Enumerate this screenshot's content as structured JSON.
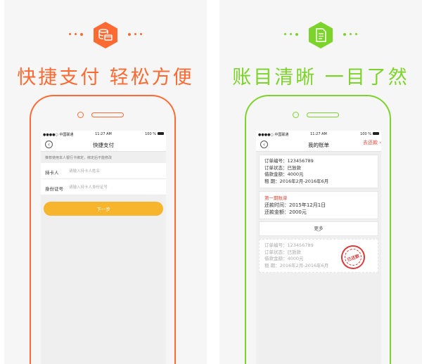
{
  "colors": {
    "orange": "#ff6a33",
    "green": "#7cd32a",
    "gold": "#f7b52e",
    "red": "#e2463a"
  },
  "left": {
    "icon": "database-card-icon",
    "headline": "快捷支付  轻松方便",
    "status": {
      "carrier": "●●●●○ 中国联通",
      "time": "11:27 AM",
      "battery": "100 %"
    },
    "nav_title": "快捷支付",
    "hint": "推荐使用本人银行卡绑定，绑定后不能修改",
    "fields": [
      {
        "label": "持卡人",
        "placeholder": "请输入持卡人姓名"
      },
      {
        "label": "身份证号",
        "placeholder": "请输入持卡人身份证号"
      }
    ],
    "next_label": "下一步"
  },
  "right": {
    "icon": "receipt-icon",
    "headline": "账目清晰  一目了然",
    "status": {
      "carrier": "●●●●○ 中国联通",
      "time": "11:27 AM",
      "battery": "100 %"
    },
    "nav_title": "我的账单",
    "order": {
      "no": "订单编号：123456789",
      "state": "订单状态：已放款",
      "amount": "借款金额：4000元",
      "period": "租      期：2016年2月-2016年6月"
    },
    "bill": {
      "title": "第一期账单",
      "time": "还款时间：2015年12月1日",
      "amount": "还款金额：2000元",
      "action": "去还款 ›"
    },
    "more_label": "更多",
    "order2": {
      "no": "订单编号：123456789",
      "state": "订单状态：已放款",
      "amount": "借款金额：4000元",
      "period": "租      期：2016年2月-2016年6月"
    },
    "stamp": "已还款"
  }
}
